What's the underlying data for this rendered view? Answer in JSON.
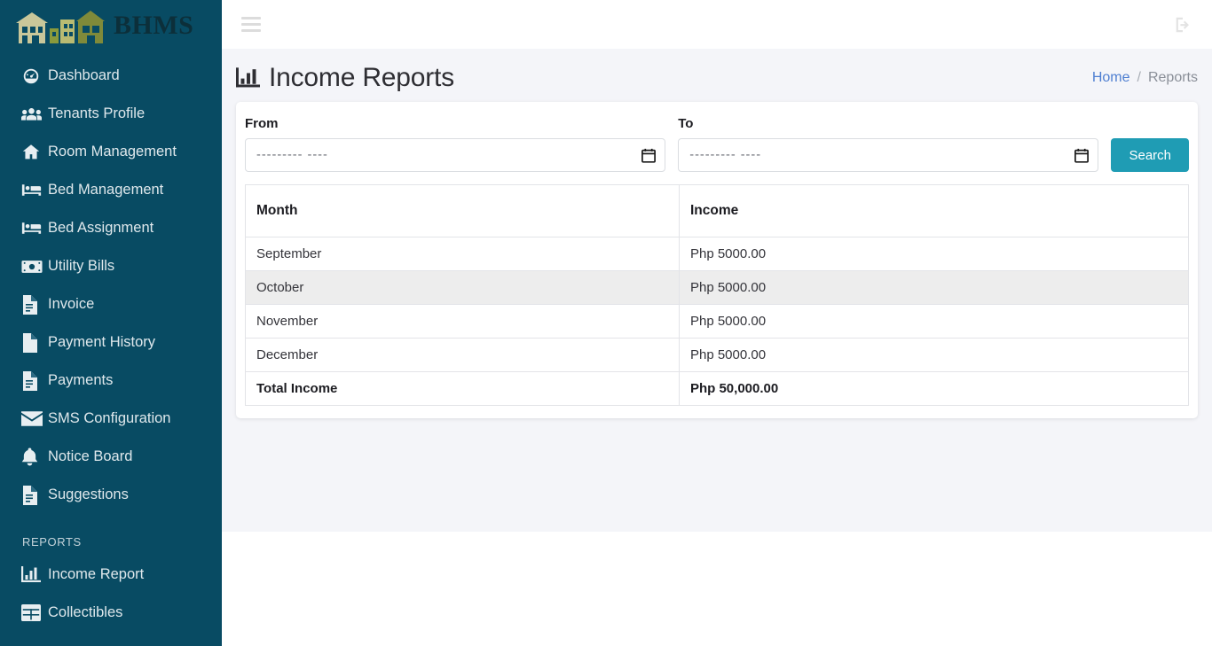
{
  "brand": {
    "name": "BHMS",
    "logo_icon": "building-skyline-icon"
  },
  "topbar": {
    "menu_toggle_icon": "hamburger-icon",
    "logout_icon": "sign-out-icon"
  },
  "sidebar": {
    "items": [
      {
        "label": "Dashboard",
        "icon": "tachometer-icon"
      },
      {
        "label": "Tenants Profile",
        "icon": "users-icon"
      },
      {
        "label": "Room Management",
        "icon": "home-icon"
      },
      {
        "label": "Bed Management",
        "icon": "bed-icon"
      },
      {
        "label": "Bed Assignment",
        "icon": "bed-icon"
      },
      {
        "label": "Utility Bills",
        "icon": "money-bill-icon"
      },
      {
        "label": "Invoice",
        "icon": "file-invoice-icon"
      },
      {
        "label": "Payment History",
        "icon": "file-icon"
      },
      {
        "label": "Payments",
        "icon": "file-invoice-icon"
      },
      {
        "label": "SMS Configuration",
        "icon": "envelope-icon"
      },
      {
        "label": "Notice Board",
        "icon": "bell-icon"
      },
      {
        "label": "Suggestions",
        "icon": "file-invoice-icon"
      }
    ],
    "section_reports": "REPORTS",
    "report_items": [
      {
        "label": "Income Report",
        "icon": "chart-bar-icon"
      },
      {
        "label": "Collectibles",
        "icon": "table-icon"
      }
    ]
  },
  "page": {
    "title": "Income Reports",
    "title_icon": "chart-bar-icon",
    "breadcrumb": {
      "home": "Home",
      "separator": "/",
      "current": "Reports"
    }
  },
  "filters": {
    "from_label": "From",
    "from_value": "--------- ----",
    "from_icon": "calendar-icon",
    "to_label": "To",
    "to_value": "--------- ----",
    "to_icon": "calendar-icon",
    "search_label": "Search"
  },
  "table": {
    "headers": {
      "month": "Month",
      "income": "Income"
    },
    "rows": [
      {
        "month": "September",
        "income": "Php 5000.00"
      },
      {
        "month": "October",
        "income": "Php 5000.00"
      },
      {
        "month": "November",
        "income": "Php 5000.00"
      },
      {
        "month": "December",
        "income": "Php 5000.00"
      }
    ],
    "total": {
      "label": "Total Income",
      "value": "Php 50,000.00"
    }
  },
  "colors": {
    "sidebar_bg": "#084b63",
    "accent_button": "#1f9cb4",
    "content_bg": "#f4f5f9",
    "breadcrumb_link": "#4f7fd1"
  }
}
